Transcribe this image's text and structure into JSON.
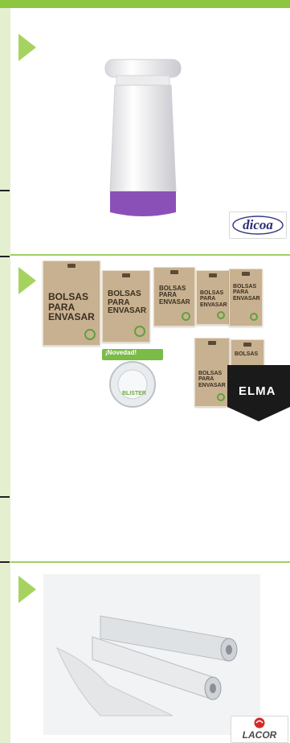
{
  "sections": [
    {
      "id": "vacuum-pump",
      "brand": "dicoa"
    },
    {
      "id": "vacuum-bags",
      "brand": "ELMA",
      "bags": [
        {
          "label": "BOLSAS\nPARA\nENVASAR"
        },
        {
          "label": "BOLSAS\nPARA\nENVASAR"
        },
        {
          "label": "BOLSAS\nPARA\nENVASAR"
        },
        {
          "label": "BOLSAS\nPARA\nENVASAR"
        },
        {
          "label": "BOLSAS\nPARA\nENVASAR"
        },
        {
          "label": "BOLSAS\nPARA\nENVASAR"
        },
        {
          "label": "BOLSAS"
        }
      ],
      "blister": {
        "badge": "¡Novedad!",
        "title": "BLISTER"
      }
    },
    {
      "id": "vacuum-rolls",
      "brand": "LACOR"
    }
  ],
  "colors": {
    "accent": "#8dc63f",
    "strip": "#e4efd0",
    "arrow": "#a6d35f",
    "pump_purple": "#8b4fb8",
    "elma_black": "#1a1a1a"
  }
}
